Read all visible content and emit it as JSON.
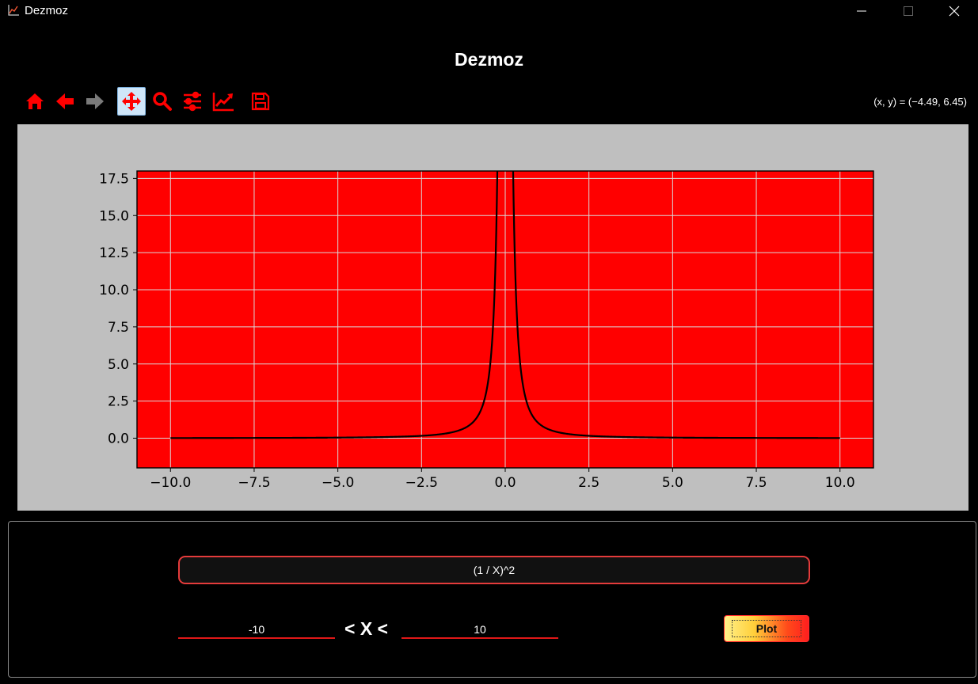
{
  "window": {
    "title": "Dezmoz"
  },
  "header": {
    "title": "Dezmoz"
  },
  "toolbar": {
    "tools": [
      {
        "icon": "home-icon"
      },
      {
        "icon": "back-arrow-icon"
      },
      {
        "icon": "forward-arrow-icon"
      },
      {
        "icon": "pan-move-icon",
        "active": true
      },
      {
        "icon": "zoom-magnifier-icon"
      },
      {
        "icon": "configure-subplots-icon"
      },
      {
        "icon": "edit-axes-icon"
      },
      {
        "icon": "save-icon"
      }
    ],
    "coordinates": "(x, y) = (−4.49, 6.45)"
  },
  "colors": {
    "accent": "#ff0000",
    "plot_background": "#ff0000",
    "figure_background": "#bfbfbf",
    "line_color": "#000000",
    "inactive_icon": "#7a7a7a"
  },
  "chart_data": {
    "type": "line",
    "function": "(1 / X)^2",
    "x_range": [
      -10,
      10
    ],
    "xlim": [
      -11,
      11
    ],
    "ylim": [
      -2,
      18
    ],
    "xticks": [
      -10.0,
      -7.5,
      -5.0,
      -2.5,
      0.0,
      2.5,
      5.0,
      7.5,
      10.0
    ],
    "xtick_labels": [
      "−10.0",
      "−7.5",
      "−5.0",
      "−2.5",
      "0.0",
      "2.5",
      "5.0",
      "7.5",
      "10.0"
    ],
    "yticks": [
      0.0,
      2.5,
      5.0,
      7.5,
      10.0,
      12.5,
      15.0,
      17.5
    ],
    "ytick_labels": [
      "0.0",
      "2.5",
      "5.0",
      "7.5",
      "10.0",
      "12.5",
      "15.0",
      "17.5"
    ],
    "grid": true,
    "title": "",
    "xlabel": "",
    "ylabel": ""
  },
  "controls": {
    "function_value": "(1 / X)^2",
    "x_min": "-10",
    "x_max": "10",
    "range_label": "< X <",
    "plot_label": "Plot"
  }
}
